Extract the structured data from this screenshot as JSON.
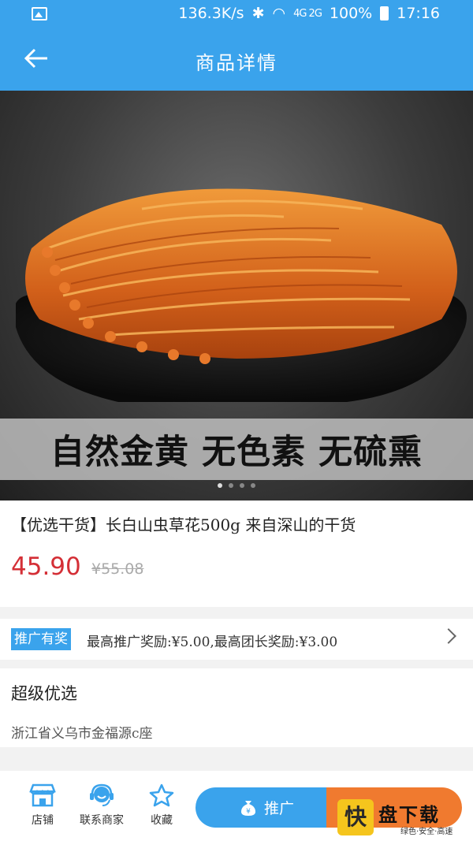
{
  "status_bar": {
    "speed": "136.3K/s",
    "network": "4G 2G",
    "battery": "100%",
    "time": "17:16"
  },
  "header": {
    "title": "商品详情"
  },
  "hero": {
    "banner_text": "自然金黄 无色素 无硫熏",
    "dots_total": 4,
    "dots_active": 1
  },
  "product": {
    "name": "【优选干货】长白山虫草花500g 来自深山的干货",
    "price": "45.90",
    "original_price": "¥55.08"
  },
  "promotion": {
    "tag": "推广有奖",
    "text": "最高推广奖励:¥5.00,最高团长奖励:¥3.00"
  },
  "shop": {
    "name": "超级优选",
    "address": "浙江省义乌市金福源c座"
  },
  "bottom_bar": {
    "store_label": "店铺",
    "contact_label": "联系商家",
    "favorite_label": "收藏",
    "promote_label": "推广"
  },
  "watermark": {
    "logo_char": "快",
    "title": "盘下载",
    "subtitle": "绿色·安全·高速"
  },
  "colors": {
    "primary": "#3aa3ec",
    "price_red": "#d42f36",
    "buy_orange": "#f07a2f"
  }
}
